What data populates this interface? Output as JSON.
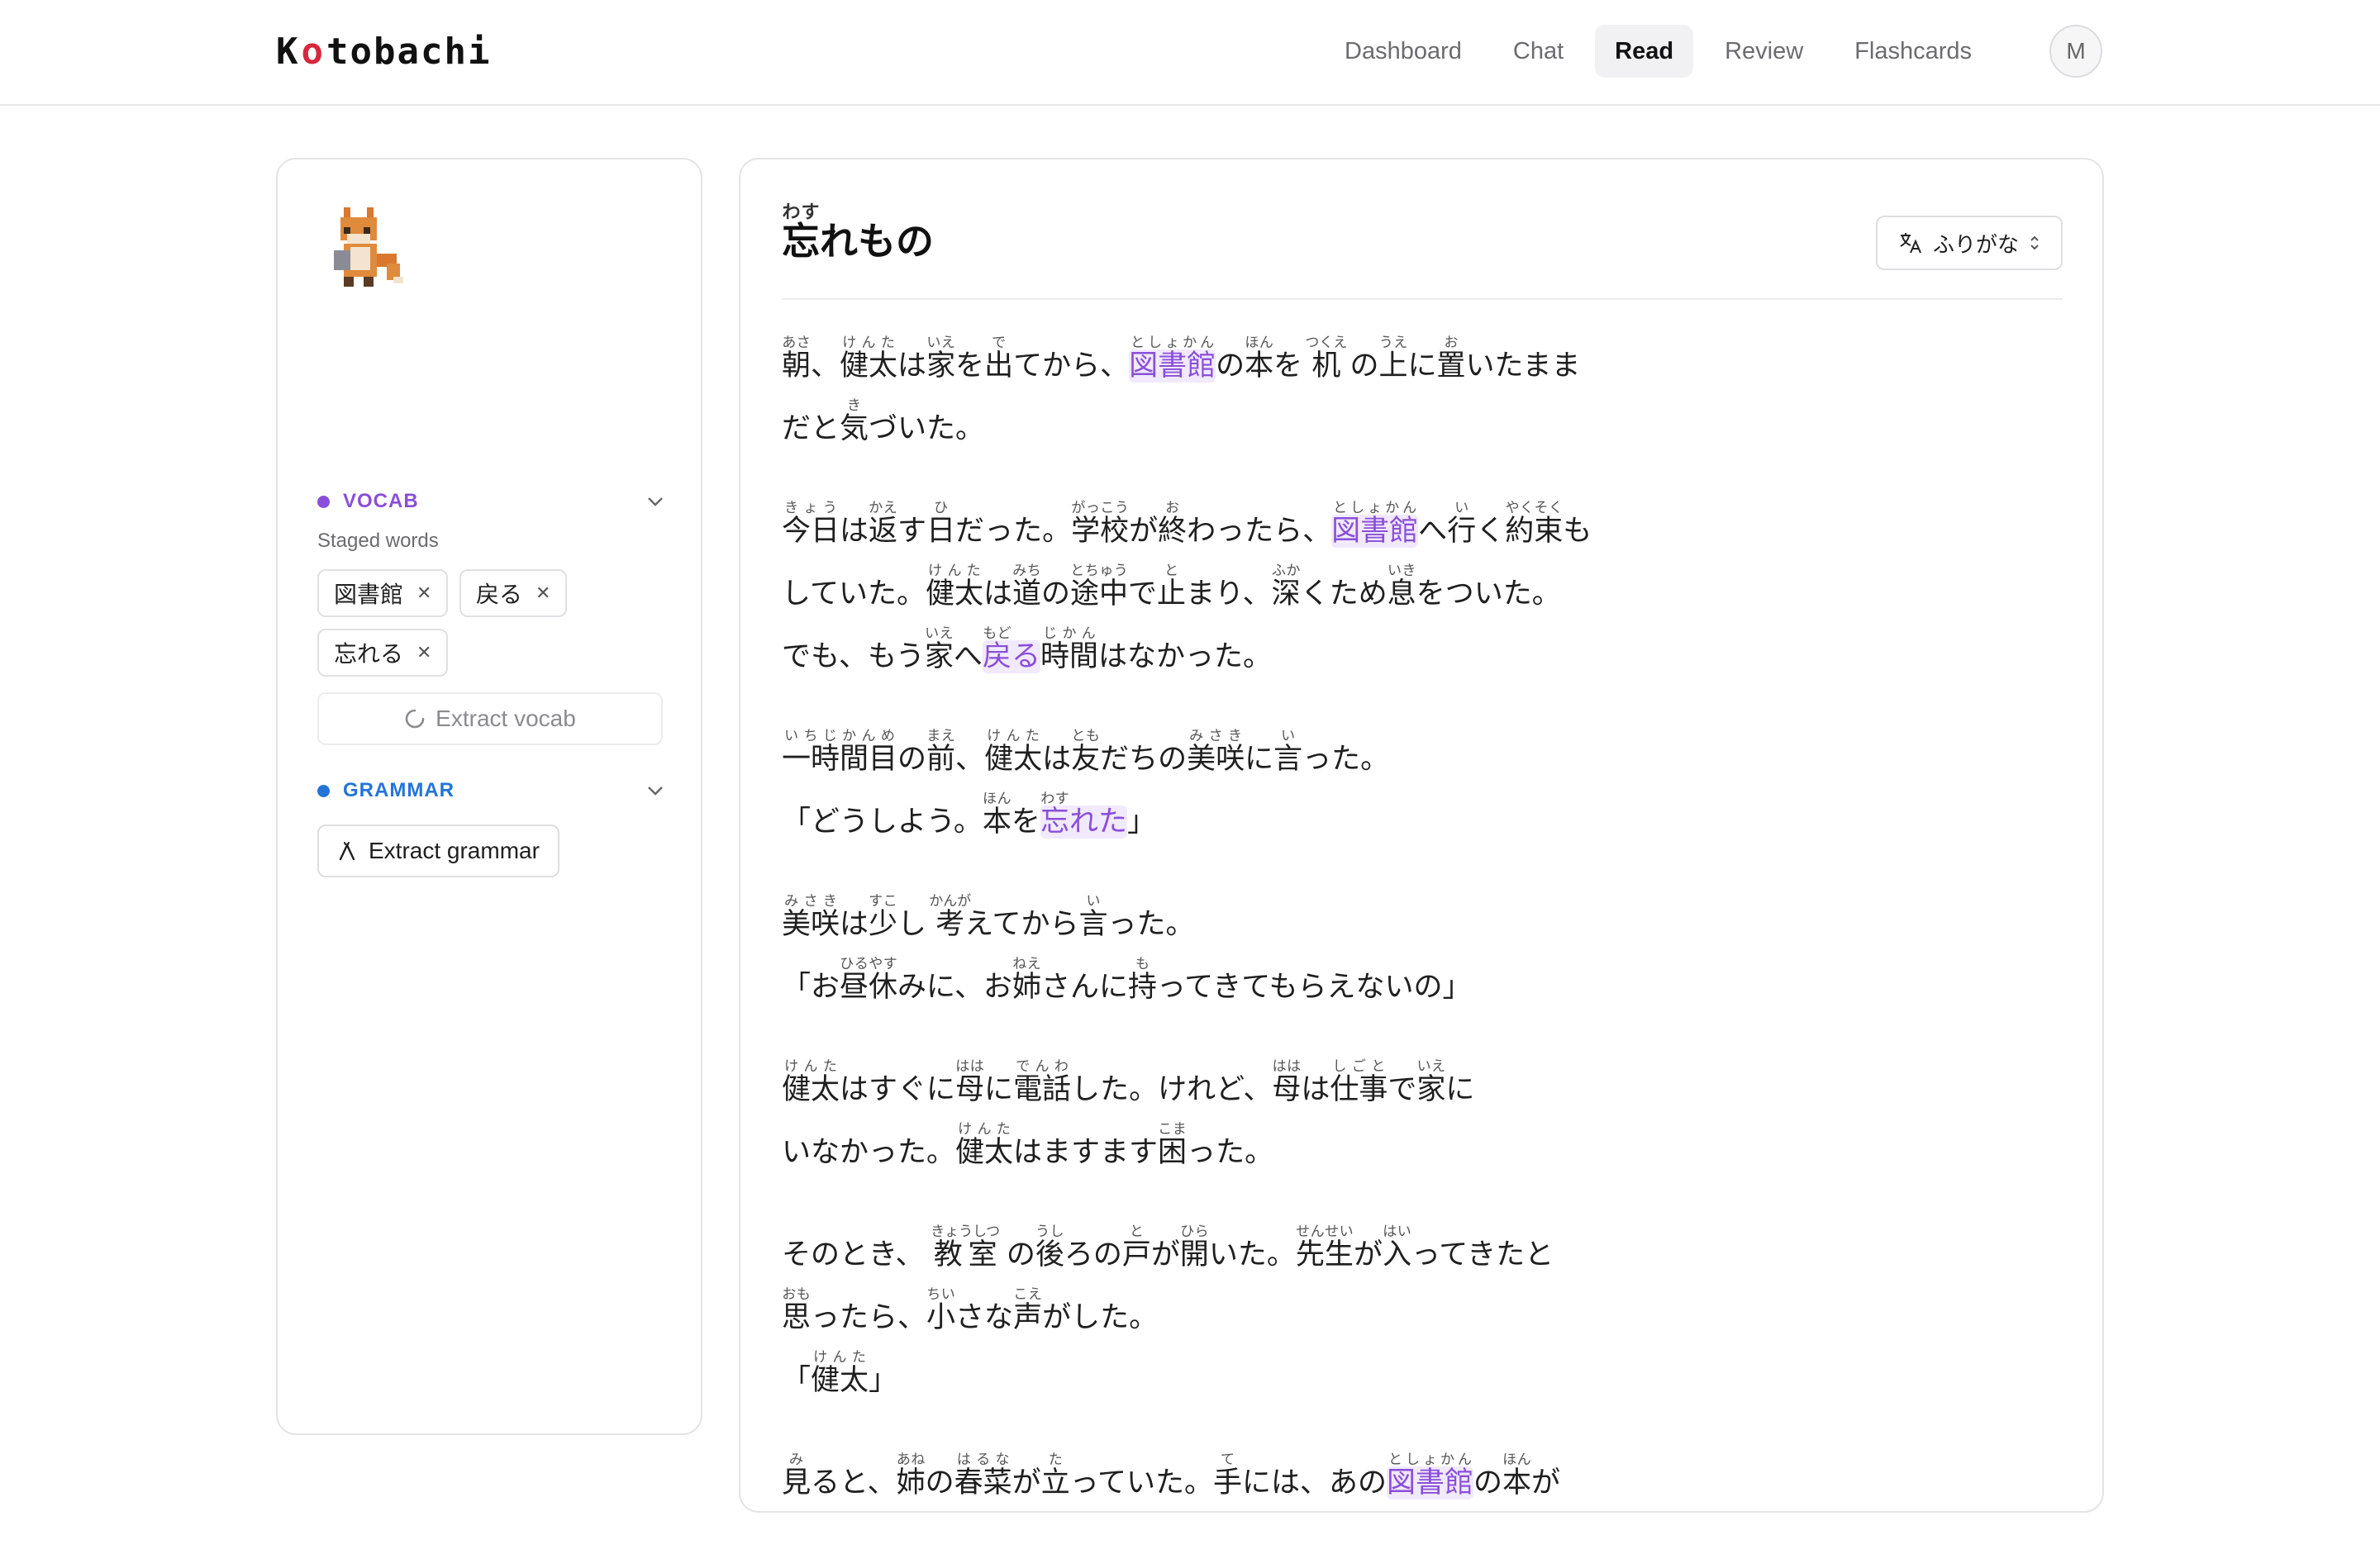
{
  "app": {
    "logo": "Kotobachi"
  },
  "nav": {
    "items": [
      "Dashboard",
      "Chat",
      "Read",
      "Review",
      "Flashcards"
    ],
    "active": "Read",
    "avatar": "M"
  },
  "sidebar": {
    "vocab": {
      "label": "VOCAB",
      "color": "#8a4fd8",
      "staged_label": "Staged words",
      "chips": [
        "図書館",
        "戻る",
        "忘れる"
      ],
      "extract_label": "Extract vocab"
    },
    "grammar": {
      "label": "GRAMMAR",
      "color": "#2474d8",
      "extract_label": "Extract grammar"
    }
  },
  "reader": {
    "title": "忘れもの",
    "title_reading": "わす",
    "furigana_select": "ふりがな",
    "highlight_color": "#8a4fd8",
    "paragraphs": [
      [
        "朝、健太は家を出てから、図書館の本を 机 の上に置いたまま",
        "だと気づいた。"
      ],
      [
        "今日は返す日だった。学校が終わったら、図書館へ行く約束も",
        "していた。健太は道の途中で止まり、深くため息をついた。",
        "でも、もう家へ戻る時間はなかった。"
      ],
      [
        "一時間目の前、健太は友だちの美咲に言った。",
        "「どうしよう。本を忘れた」"
      ],
      [
        "美咲は少し 考えてから言った。",
        "「お昼休みに、お姉さんに持ってきてもらえないの」"
      ],
      [
        "健太はすぐに母に電話した。けれど、母は仕事で家に",
        "いなかった。健太はますます困った。"
      ],
      [
        "そのとき、 教室 の後ろの戸が開いた。先生が入ってきたと",
        "思ったら、小さな声がした。",
        "「健太」"
      ],
      [
        "見ると、姉の春菜が立っていた。手には、あの図書館の本が"
      ]
    ]
  }
}
